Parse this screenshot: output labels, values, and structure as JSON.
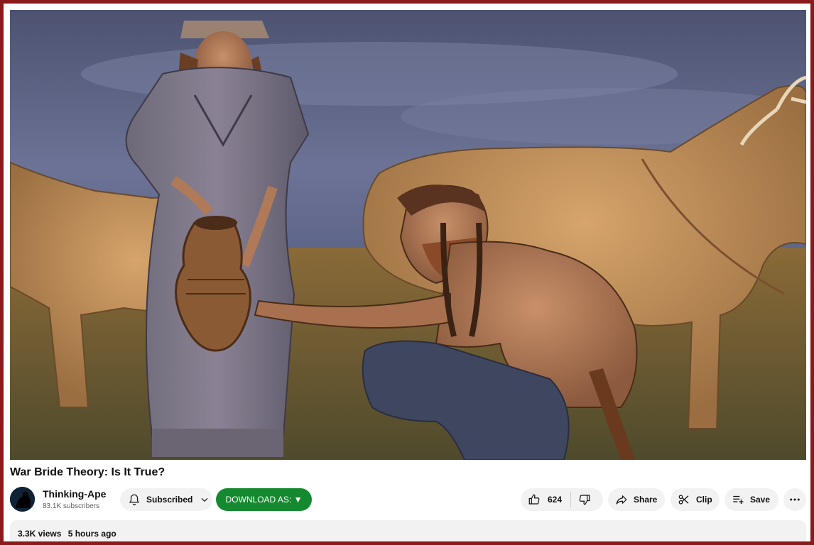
{
  "video": {
    "title": "War Bride Theory: Is It True?"
  },
  "channel": {
    "name": "Thinking-Ape",
    "subscribers": "83.1K subscribers"
  },
  "actions": {
    "subscribe_label": "Subscribed",
    "download_label": "DOWNLOAD AS: ▼",
    "like_count": "624",
    "share_label": "Share",
    "clip_label": "Clip",
    "save_label": "Save"
  },
  "description": {
    "views": "3.3K views",
    "age": "5 hours ago"
  },
  "icons": {
    "subscribe": "bell-icon",
    "subscribe_menu": "chevron-down-icon",
    "like": "thumb-up-icon",
    "dislike": "thumb-down-icon",
    "share": "share-arrow-icon",
    "clip": "scissors-icon",
    "save": "playlist-add-icon",
    "more": "more-horizontal-icon"
  },
  "colors": {
    "frame": "#8b1a1a",
    "download_button": "#15892f",
    "pill_background": "#f2f2f2"
  }
}
